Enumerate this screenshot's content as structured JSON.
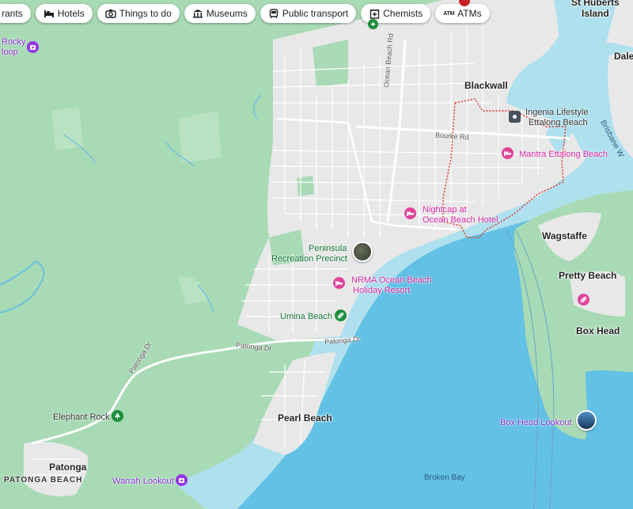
{
  "filter_chips": [
    {
      "label": "rants",
      "icon": "restaurant-icon"
    },
    {
      "label": "Hotels",
      "icon": "bed-icon"
    },
    {
      "label": "Things to do",
      "icon": "camera-icon"
    },
    {
      "label": "Museums",
      "icon": "museum-icon"
    },
    {
      "label": "Public transport",
      "icon": "train-icon"
    },
    {
      "label": "Chemists",
      "icon": "pharmacy-icon"
    },
    {
      "label": "ATMs",
      "icon": "atm-icon",
      "icon_text": "ATM"
    }
  ],
  "places": {
    "st_huberts_line1": "St Huberts",
    "st_huberts_line2": "Island",
    "daley": "Dale",
    "blackwall": "Blackwall",
    "wagstaffe": "Wagstaffe",
    "pretty_beach": "Pretty Beach",
    "box_head": "Box Head",
    "pearl_beach": "Pearl Beach",
    "patonga": "Patonga",
    "patonga_beach": "PATONGA BEACH",
    "umina_beach": "Umina Beach"
  },
  "pois": {
    "rocky_line1": "Rocky",
    "rocky_line2": "loop",
    "ingenia_line1": "Ingenia Lifestyle",
    "ingenia_line2": "Ettalong Beach",
    "mantra": "Mantra Ettalong Beach",
    "nightcap_line1": "Nightcap at",
    "nightcap_line2": "Ocean Beach Hotel",
    "peninsula_line1": "Peninsula",
    "peninsula_line2": "Recreation Precinct",
    "nrma_line1": "NRMA Ocean Beach",
    "nrma_line2": "Holiday Resort",
    "elephant_rock": "Elephant Rock",
    "warrah_lookout": "Warrah Lookout",
    "box_head_lookout": "Box Head Lookout"
  },
  "roads": {
    "ocean_beach_rd": "Ocean Beach Rd",
    "bourke_rd": "Bourke Rd",
    "patonga_dr_1": "Patonga Dr",
    "patonga_dr_2": "Patonga Dr",
    "patonga_dr_3": "Patonga Dr",
    "brisbane_water": "Brisbane W"
  },
  "water_bodies": {
    "broken_bay": "Broken Bay"
  },
  "colors": {
    "water": "#aee0ee",
    "deep_water": "#62c1e5",
    "park": "#a8dab5",
    "urban": "#ebebeb",
    "road": "#ffffff",
    "hotel_pin": "#e0449a",
    "park_pin": "#1e8e3e",
    "attraction_pin": "#9334e6",
    "boundary": "#d93025"
  }
}
